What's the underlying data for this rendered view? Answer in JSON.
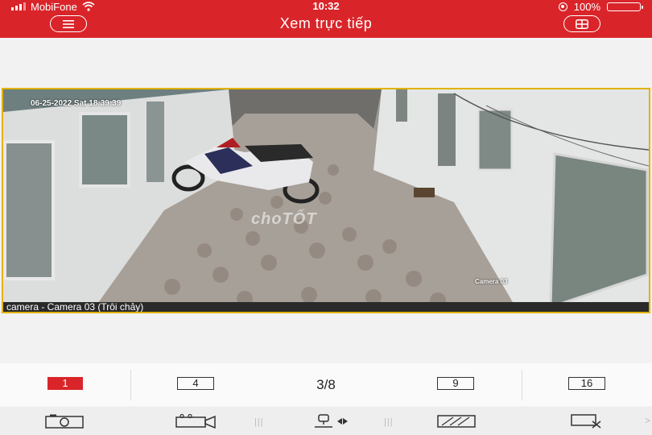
{
  "status": {
    "carrier": "MobiFone",
    "time": "10:32",
    "battery": "100%"
  },
  "header": {
    "title": "Xem trực tiếp",
    "menu_icon": "menu-icon",
    "layout_icon": "layout-icon"
  },
  "video": {
    "osd_datetime": "06-25-2022 Sat 18:39:39",
    "osd_camera": "Camera 03",
    "watermark": "choTỐT",
    "caption": "camera - Camera 03 (Trôi chảy)"
  },
  "layout": {
    "options": [
      "1",
      "4",
      "9",
      "16"
    ],
    "selected": "1",
    "page_indicator": "3/8"
  },
  "toolbar": {
    "icons": [
      "snapshot-icon",
      "record-icon",
      "ptz-icon",
      "fisheye-icon",
      "close-video-icon"
    ]
  },
  "colors": {
    "accent": "#d9252a",
    "video_border": "#e2b300"
  }
}
